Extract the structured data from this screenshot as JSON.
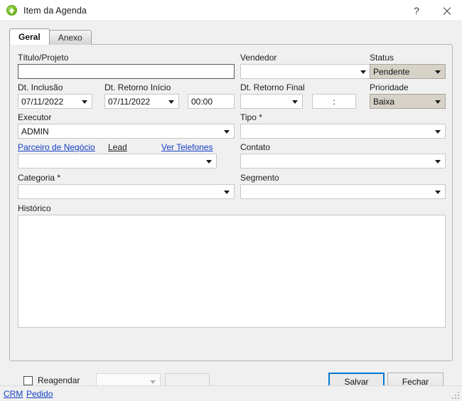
{
  "window": {
    "title": "Item da Agenda",
    "icon": "green-plus-icon",
    "help_label": "?",
    "close_label": "✕"
  },
  "tabs": [
    {
      "label": "Geral",
      "active": true
    },
    {
      "label": "Anexo",
      "active": false
    }
  ],
  "form": {
    "titulo_projeto": {
      "label": "Título/Projeto",
      "value": ""
    },
    "dt_inclusao": {
      "label": "Dt. Inclusão",
      "value": "07/11/2022"
    },
    "dt_retorno_inicio": {
      "label": "Dt. Retorno Início",
      "value": "07/11/2022"
    },
    "hora_retorno_inicio": {
      "value": "00:00"
    },
    "executor": {
      "label": "Executor",
      "value": "ADMIN"
    },
    "vendedor": {
      "label": "Vendedor",
      "value": ""
    },
    "dt_retorno_final": {
      "label": "Dt. Retorno Final",
      "value": ""
    },
    "hora_retorno_final": {
      "value": ":"
    },
    "tipo": {
      "label": "Tipo *",
      "value": ""
    },
    "status": {
      "label": "Status",
      "value": "Pendente"
    },
    "prioridade": {
      "label": "Prioridade",
      "value": "Baixa"
    },
    "parceiro_negocio_link": "Parceiro de Negócio",
    "lead_link": "Lead",
    "ver_telefones_link": "Ver Telefones",
    "parceiro_combo": {
      "value": ""
    },
    "categoria": {
      "label": "Categoria *",
      "value": ""
    },
    "contato": {
      "label": "Contato",
      "value": ""
    },
    "segmento": {
      "label": "Segmento",
      "value": ""
    },
    "historico": {
      "label": "Histórico",
      "value": ""
    }
  },
  "footer": {
    "reagendar_label": "Reagendar",
    "reagendar_checked": false,
    "reagendar_combo_value": "",
    "reagendar_text_value": "",
    "save_label": "Salvar",
    "close_label": "Fechar"
  },
  "statusbar": {
    "crm_link": "CRM",
    "pedido_link": "Pedido"
  },
  "colors": {
    "accent": "#0078d7",
    "link": "#1540c4",
    "icon_green": "#76bc21",
    "shaded_field": "#d6d2c8"
  }
}
